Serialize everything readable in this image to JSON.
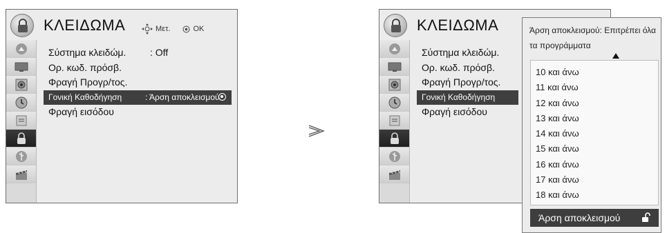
{
  "left_menu": {
    "title": "ΚΛΕΙΔΩΜΑ",
    "hint_move": "Μετ.",
    "hint_ok": "OK",
    "items": [
      {
        "label": "Σύστημα κλειδώμ.",
        "value": ": Off"
      },
      {
        "label": "Ορ. κωδ. πρόσβ.",
        "value": ""
      },
      {
        "label": "Φραγή Προγρ/τος.",
        "value": ""
      },
      {
        "label": "Γονική Καθοδήγηση",
        "value": ": Άρση αποκλεισμού"
      },
      {
        "label": "Φραγή εισόδου",
        "value": ""
      }
    ],
    "selected_index": 3
  },
  "right_menu": {
    "title": "ΚΛΕΙΔΩΜΑ",
    "items": [
      {
        "label": "Σύστημα κλειδώμ."
      },
      {
        "label": "Ορ. κωδ. πρόσβ."
      },
      {
        "label": "Φραγή Προγρ/τος."
      },
      {
        "label": "Γονική Καθοδήγηση"
      },
      {
        "label": "Φραγή εισόδου"
      }
    ]
  },
  "separator": ">",
  "popup": {
    "description": "Άρση αποκλεισμού: Επιτρέπει όλα τα προγράμματα",
    "options": [
      "10 και άνω",
      "11 και άνω",
      "12 και άνω",
      "13 και άνω",
      "14 και άνω",
      "15 και άνω",
      "16 και άνω",
      "17 και άνω",
      "18 και άνω"
    ],
    "selected_label": "Άρση αποκλεισμού"
  },
  "icons": [
    "picture-icon",
    "screen-icon",
    "audio-icon",
    "time-icon",
    "option-icon",
    "lock-icon",
    "usb-icon",
    "movie-icon"
  ],
  "colors": {
    "menu_bg": "#ececec",
    "selection_bg": "#3f3f3f",
    "icon_col_bg": "#dadada"
  }
}
